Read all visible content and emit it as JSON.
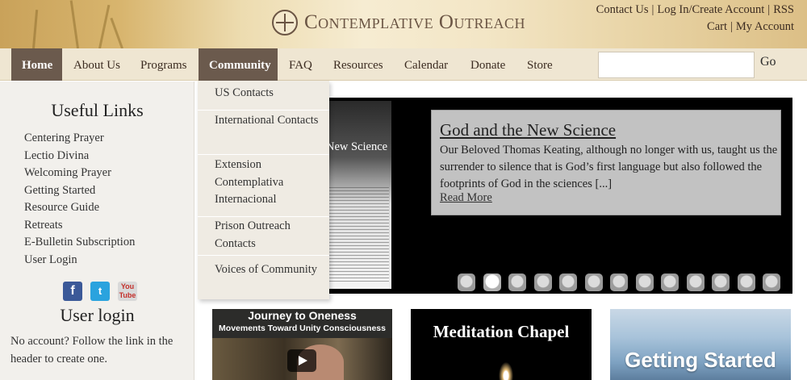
{
  "header": {
    "logo_text": "Contemplative Outreach",
    "top_links": [
      "Contact Us",
      "Log In/Create Account",
      "RSS",
      "Cart",
      "My Account"
    ]
  },
  "nav": {
    "items": [
      "Home",
      "About Us",
      "Programs",
      "Community",
      "FAQ",
      "Resources",
      "Calendar",
      "Donate",
      "Store"
    ],
    "active": "Home",
    "hovered": "Community",
    "search_placeholder": "",
    "search_button": "Go"
  },
  "dropdown": {
    "items": [
      "US Contacts",
      "International Contacts",
      "Extension Contemplativa Internacional",
      "Prison Outreach Contacts",
      "Voices of Community"
    ]
  },
  "sidebar": {
    "useful_links_title": "Useful Links",
    "links": [
      "Centering Prayer",
      "Lectio Divina",
      "Welcoming Prayer",
      "Getting Started",
      "Resource Guide",
      "Retreats",
      "E-Bulletin Subscription",
      "User Login"
    ],
    "social_icons": [
      "facebook-icon",
      "twitter-icon",
      "youtube-icon"
    ],
    "social_labels": {
      "facebook": "f",
      "twitter": "t",
      "youtube": "You Tube"
    },
    "login_title": "User login",
    "login_text": "No account? Follow the link in the header to create one."
  },
  "slider": {
    "book_title": "New Science",
    "title": "God and the New Science",
    "text": "Our Beloved Thomas Keating, although no longer with us, taught us the surrender to silence that is God’s first language but also followed the footprints of God in the sciences [...]",
    "read_more": "Read More",
    "dot_count": 13,
    "active_dot": 2
  },
  "tiles": {
    "journey_title": "Journey to Oneness",
    "journey_subtitle": "Movements Toward Unity Consciousness",
    "chapel_title": "Meditation Chapel",
    "start_title": "Getting Started"
  }
}
